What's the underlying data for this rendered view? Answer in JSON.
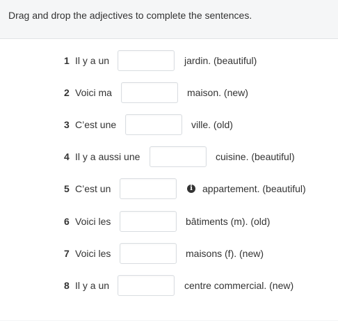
{
  "instructions": "Drag and drop the adjectives to complete the sentences.",
  "sentences": [
    {
      "number": "1",
      "before": "Il y a un",
      "after": "jardin. (beautiful)"
    },
    {
      "number": "2",
      "before": "Voici ma",
      "after": "maison. (new)"
    },
    {
      "number": "3",
      "before": "C’est une",
      "after": "ville. (old)"
    },
    {
      "number": "4",
      "before": "Il y a aussi une",
      "after": "cuisine. (beautiful)"
    },
    {
      "number": "5",
      "before": "C’est un",
      "after": "appartement. (beautiful)"
    },
    {
      "number": "6",
      "before": "Voici les",
      "after": "bâtiments (m). (old)"
    },
    {
      "number": "7",
      "before": "Voici les",
      "after": "maisons (f). (new)"
    },
    {
      "number": "8",
      "before": "Il y a un",
      "after": "centre commercial. (new)"
    }
  ],
  "icons": {
    "info": "info-icon"
  }
}
